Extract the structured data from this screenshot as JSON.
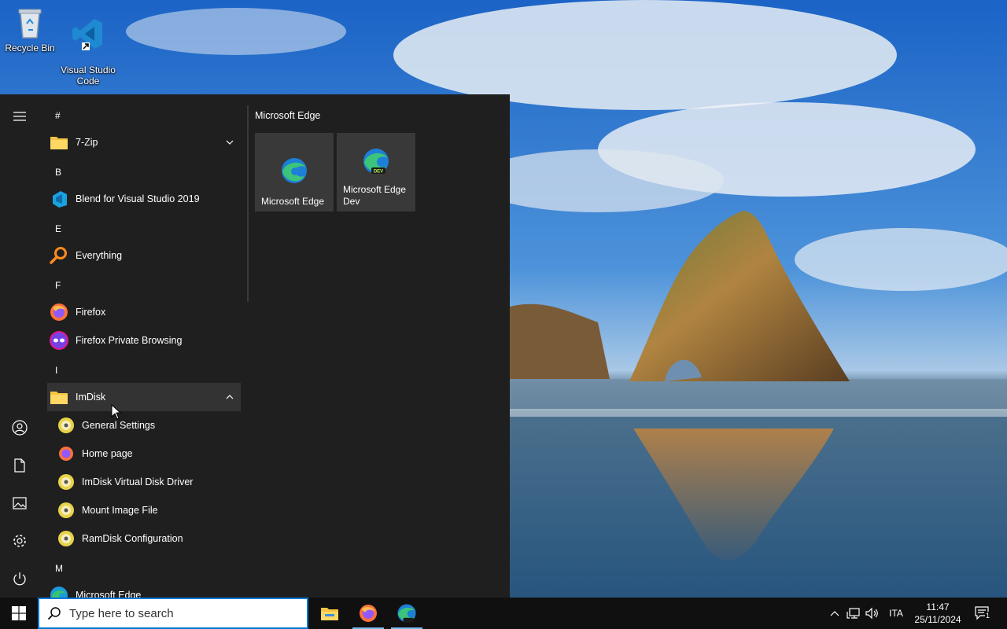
{
  "desktop": {
    "icons": [
      {
        "label": "Recycle Bin",
        "icon": "recycle-bin-icon"
      },
      {
        "label": "Visual Studio\nCode",
        "icon": "vscode-icon"
      }
    ]
  },
  "start_menu": {
    "letters": [
      "#",
      "B",
      "E",
      "F",
      "I",
      "M"
    ],
    "apps": [
      {
        "label": "7-Zip",
        "icon": "folder-icon",
        "expandable": true
      },
      {
        "label": "Blend for Visual Studio 2019",
        "icon": "blend-icon"
      },
      {
        "label": "Everything",
        "icon": "everything-search-icon"
      },
      {
        "label": "Firefox",
        "icon": "firefox-icon"
      },
      {
        "label": "Firefox Private Browsing",
        "icon": "firefox-private-icon"
      },
      {
        "label": "ImDisk",
        "icon": "folder-icon",
        "expanded": true
      },
      {
        "label": "General Settings",
        "icon": "disk-icon"
      },
      {
        "label": "Home page",
        "icon": "firefox-icon"
      },
      {
        "label": "ImDisk Virtual Disk Driver",
        "icon": "disk-icon"
      },
      {
        "label": "Mount Image File",
        "icon": "disk-icon"
      },
      {
        "label": "RamDisk Configuration",
        "icon": "disk-icon"
      },
      {
        "label": "Microsoft Edge",
        "icon": "edge-icon"
      }
    ],
    "tile_group": "Microsoft Edge",
    "tiles": [
      {
        "label": "Microsoft Edge",
        "icon": "edge-icon"
      },
      {
        "label": "Microsoft Edge\nDev",
        "icon": "edge-dev-icon"
      }
    ],
    "rail": [
      "hamburger-menu-icon",
      "user-icon",
      "documents-icon",
      "pictures-icon",
      "settings-icon",
      "power-icon"
    ]
  },
  "taskbar": {
    "search_placeholder": "Type here to search",
    "apps": [
      "file-explorer-icon",
      "firefox-icon",
      "edge-dev-icon"
    ],
    "language": "ITA",
    "time": "11:47",
    "date": "25/11/2024",
    "notifications_count": "1"
  },
  "colors": {
    "start_bg": "#1f1f1f",
    "tile_bg": "#393939",
    "taskbar_bg": "#101010",
    "accent": "#0078d7"
  }
}
